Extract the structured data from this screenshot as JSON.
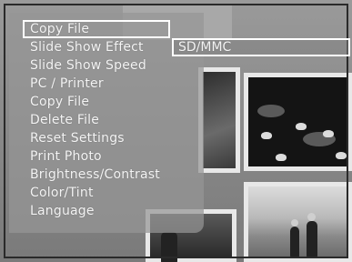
{
  "menu": {
    "items": [
      {
        "label": "Copy File"
      },
      {
        "label": "Slide Show Effect"
      },
      {
        "label": "Slide Show Speed"
      },
      {
        "label": "PC / Printer"
      },
      {
        "label": "Copy File"
      },
      {
        "label": "Delete File"
      },
      {
        "label": "Reset Settings"
      },
      {
        "label": "Print Photo"
      },
      {
        "label": "Brightness/Contrast"
      },
      {
        "label": "Color/Tint"
      },
      {
        "label": "Language"
      }
    ],
    "selected_index": 0
  },
  "submenu": {
    "value": "SD/MMC"
  }
}
